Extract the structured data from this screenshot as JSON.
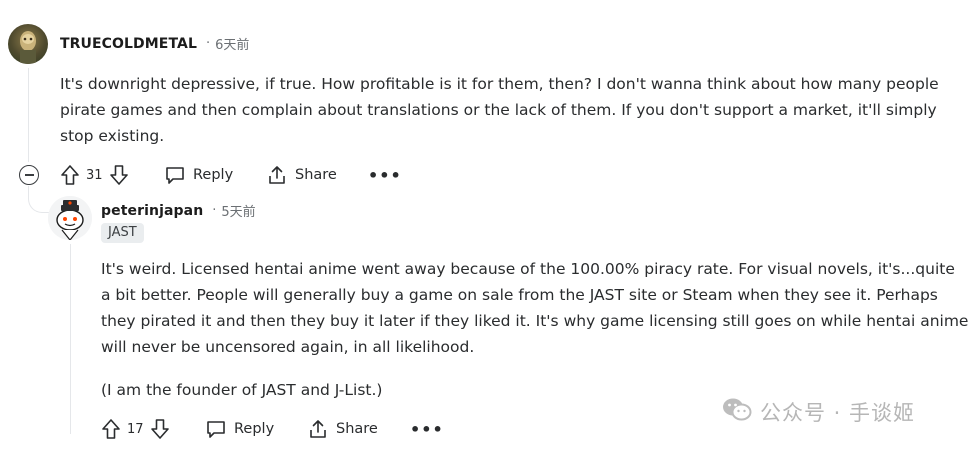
{
  "comment1": {
    "username": "TRUECOLDMETAL",
    "time": "6天前",
    "body": "It's downright depressive, if true. How profitable is it for them, then? I don't wanna think about how many people pirate games and then complain about translations or the lack of them. If you don't support a market, it'll simply stop existing.",
    "votes": "31",
    "reply_label": "Reply",
    "share_label": "Share",
    "more_label": "•••"
  },
  "comment2": {
    "username": "peterinjapan",
    "time": "5天前",
    "flair": "JAST",
    "body_p1": "It's weird. Licensed hentai anime went away because of the 100.00% piracy rate. For visual novels, it's...quite a bit better. People will generally buy a game on sale from the JAST site or Steam when they see it. Perhaps they pirated it and then they buy it later if they liked it. It's why game licensing still goes on while hentai anime will never be uncensored again, in all likelihood.",
    "body_p2": "(I am the founder of JAST and J-List.)",
    "votes": "17",
    "reply_label": "Reply",
    "share_label": "Share",
    "more_label": "•••"
  },
  "separator": "·",
  "watermark": {
    "text": "公众号 · 手谈姬",
    "icon": "wechat-icon"
  }
}
